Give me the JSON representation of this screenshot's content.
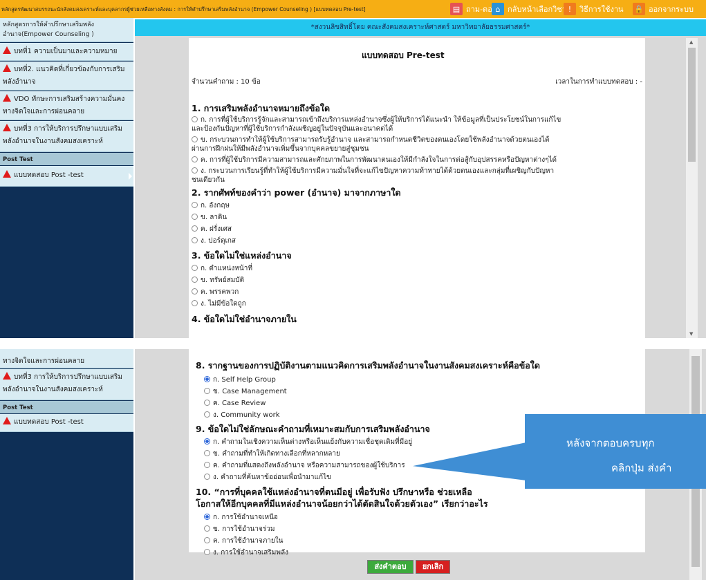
{
  "topbar": {
    "course_title": "หลักสูตรพัฒนาสมรรถนะนักสังคมสงเคราะห์และบุคลากรผู้ช่วยเหลือทางสังคม : การให้คำปรึกษาเสริมพลังอำนาจ (Empower Counseling ) [แบบทดสอบ Pre-test]",
    "nav": [
      "ถาม-ตอบ",
      "กลับหน้าเลือกวิชา",
      "วิธีการใช้งาน",
      "ออกจากระบบ"
    ],
    "nav_icons": [
      "chat-icon",
      "home-icon",
      "info-icon",
      "lock-icon"
    ],
    "color": "#f6ae14"
  },
  "sidebar": {
    "course_head": "หลักสูตรการให้คำปรึกษาเสริมพลังอำนาจ(Empower Counseling )",
    "items": [
      "บทที่1 ความเป็นมาและความหมาย",
      "บทที่2. แนวคิดที่เกี่ยวข้องกับการเสริมพลังอำนาจ",
      "VDO ทักษะการเสริมสร้างความมั่นคงทางจิตใจและการผ่อนคลาย",
      "บทที่3 การให้บริการปรึกษาแบบเสริมพลังอำนาจในงานสังคมสงเคราะห์"
    ],
    "post_heading": "Post Test",
    "post_item": "แบบทดสอบ Post -test",
    "bottom_partial": "ทางจิตใจและการผ่อนคลาย"
  },
  "header_band": "*สงวนลิขสิทธิ์โดย คณะสังคมสงเคราะห์ศาสตร์ มหาวิทยาลัยธรรมศาสตร์*",
  "quiz": {
    "title": "แบบทดสอบ Pre-test",
    "count_label": "จำนวนคำถาม : 10 ข้อ",
    "time_label": "เวลาในการทำแบบทดสอบ : -",
    "questions_top": [
      {
        "title": "1. การเสริมพลังอำนาจหมายถึงข้อใด",
        "options": [
          "ก. การที่ผู้ใช้บริการรู้จักและสามารถเข้าถึงบริการแหล่งอำนาจซึ่งผู้ให้บริการได้แนะนำ ให้ข้อมูลที่เป็นประโยชน์ในการแก้ไข",
          "และป้องกันปัญหาที่ผู้ใช้บริการกำลังเผชิญอยู่ในปัจจุบันและอนาคตได้",
          "ข. กระบวนการทำให้ผู้ใช้บริการสามารถรับรู้อำนาจ และสามารถกำหนดชีวิตของตนเองโดยใช้พลังอำนาจด้วยตนเองได้",
          "ผ่านการฝึกฝนให้มีพลังอำนาจเพิ่มขึ้นจากบุคคลขยายสู่ชุมชน",
          "ค. การที่ผู้ใช้บริการมีความสามารถและศักยภาพในการพัฒนาตนเองให้มีกำลังใจในการต่อสู้กับอุปสรรคหรือปัญหาต่างๆได้",
          "ง. กระบวนการเรียนรู้ที่ทำให้ผู้ใช้บริการมีความมั่นใจที่จะแก้ไขปัญหาความท้าทายได้ด้วยตนเองและกลุ่มที่เผชิญกับปัญหา",
          "ชนเดียวกัน"
        ]
      },
      {
        "title": "2. รากศัพท์ของคำว่า power (อำนาจ) มาจากภาษาใด",
        "options": [
          "ก. อังกฤษ",
          "ข. ลาติน",
          "ค. ฝรั่งเศส",
          "ง. ปอร์ตุเกส"
        ]
      },
      {
        "title": "3. ข้อใดไม่ใช่แหล่งอำนาจ",
        "options": [
          "ก. ตำแหน่งหน้าที่",
          "ข. ทรัพย์สมบัติ",
          "ค. พรรคพวก",
          "ง. ไม่มีข้อใดถูก"
        ]
      },
      {
        "title": "4. ข้อใดไม่ใช่อำนาจภายใน",
        "options": []
      }
    ],
    "questions_bottom": [
      {
        "title": "8. รากฐานของการปฏิบัติงานตามแนวคิดการเสริมพลังอำนาจในงานสังคมสงเคราะห์คือข้อใด",
        "options": [
          "ก. Self Help Group",
          "ข. Case Management",
          "ค. Case Review",
          "ง. Community work"
        ],
        "selected": 0
      },
      {
        "title": "9. ข้อใดไม่ใช่ลักษณะคำถามที่เหมาะสมกับการเสริมพลังอำนาจ",
        "options": [
          "ก. คำถามในเชิงความเห็นต่างหรือเห็นแย้งกับความเชื่อชุดเดิมที่มีอยู่",
          "ข. คำถามที่ทำให้เกิดทางเลือกที่หลากหลาย",
          "ค. คำถามที่แสดงถึงพลังอำนาจ หรือความสามารถของผู้ใช้บริการ",
          "ง. คำถามที่ค้นหาข้ออ่อนเพื่อนำมาแก้ไข"
        ],
        "selected": 0
      },
      {
        "title": "10. “การที่บุคคลใช้แหล่งอำนาจที่ตนมีอยู่ เพื่อรับฟัง ปรึกษาหรือ ช่วยเหลือ",
        "title2": "โอกาสให้อีกบุคคลที่มีแหล่งอำนาจน้อยกว่าได้ตัดสินใจด้วยตัวเอง” เรียกว่าอะไร",
        "options": [
          "ก. การใช้อำนาจเหนือ",
          "ข. การใช้อำนาจร่วม",
          "ค. การใช้อำนาจภายใน",
          "ง. การใช้อำนาจเสริมพลัง"
        ],
        "selected": 0
      }
    ],
    "submit_label": "ส่งคำตอบ",
    "cancel_label": "ยกเลิก"
  },
  "tooltip": {
    "line1": "หลังจากตอบครบทุก",
    "line2": "คลิกปุ่ม ส่งคำ",
    "color": "#3f8ed4"
  }
}
